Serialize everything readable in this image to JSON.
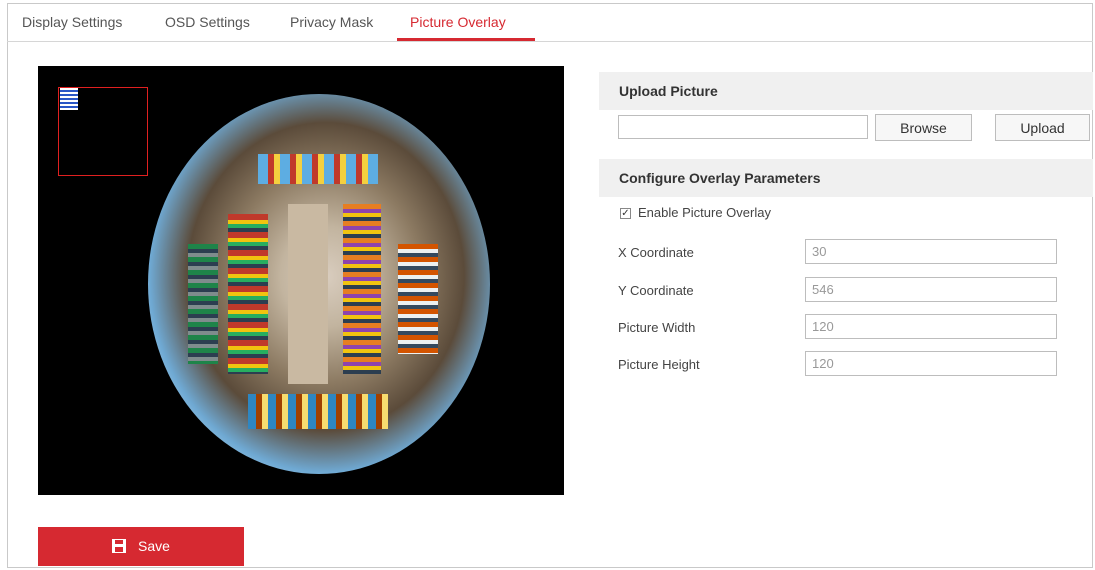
{
  "tabs": [
    {
      "label": "Display Settings"
    },
    {
      "label": "OSD Settings"
    },
    {
      "label": "Privacy Mask"
    },
    {
      "label": "Picture Overlay"
    }
  ],
  "active_tab": "Picture Overlay",
  "upload": {
    "title": "Upload Picture",
    "file_value": "",
    "browse_label": "Browse",
    "upload_label": "Upload"
  },
  "overlay": {
    "title": "Configure Overlay Parameters",
    "enable_label": "Enable Picture Overlay",
    "enabled": true,
    "fields": [
      {
        "label": "X Coordinate",
        "value": "30"
      },
      {
        "label": "Y Coordinate",
        "value": "546"
      },
      {
        "label": "Picture Width",
        "value": "120"
      },
      {
        "label": "Picture Height",
        "value": "120"
      }
    ]
  },
  "save_label": "Save",
  "colors": {
    "accent": "#d62931",
    "section_bg": "#f0f0f0",
    "video_bg": "#000000"
  },
  "icons": {
    "save": "floppy-disk-icon",
    "checkbox": "checkbox-checked-icon"
  }
}
